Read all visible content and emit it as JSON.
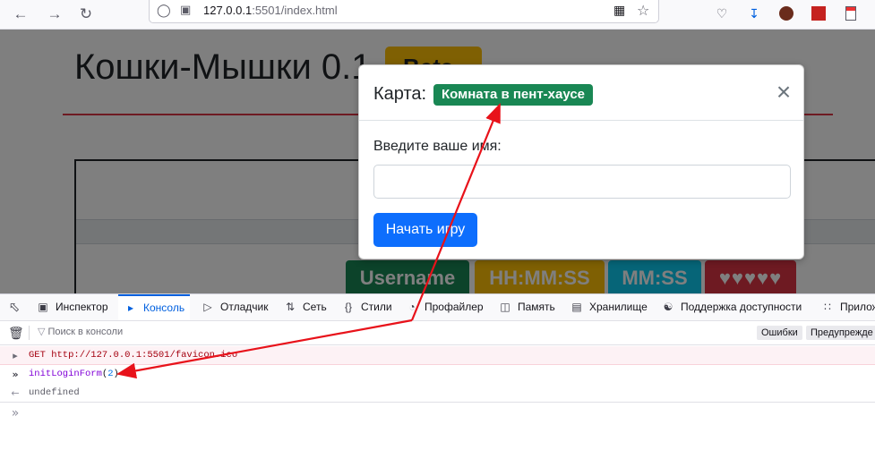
{
  "browser": {
    "url_host": "127.0.0.1",
    "url_rest": ":5501/index.html"
  },
  "page": {
    "title": "Кошки-Мышки 0.1",
    "title_badge": "Beta",
    "stats": [
      "Username",
      "HH:MM:SS",
      "MM:SS",
      "♥♥♥♥♥"
    ]
  },
  "modal": {
    "title": "Карта:",
    "map_badge": "Комната в пент-хаусе",
    "name_label": "Введите ваше имя:",
    "name_value": "",
    "start_button": "Начать игру"
  },
  "devtools": {
    "tabs": [
      {
        "label": "Инспектор",
        "icon": "inspector-icon"
      },
      {
        "label": "Консоль",
        "icon": "console-icon"
      },
      {
        "label": "Отладчик",
        "icon": "debugger-icon"
      },
      {
        "label": "Сеть",
        "icon": "network-icon"
      },
      {
        "label": "Стили",
        "icon": "styles-icon"
      },
      {
        "label": "Профайлер",
        "icon": "profiler-icon"
      },
      {
        "label": "Память",
        "icon": "memory-icon"
      },
      {
        "label": "Хранилище",
        "icon": "storage-icon"
      },
      {
        "label": "Поддержка доступности",
        "icon": "accessibility-icon"
      },
      {
        "label": "Прилож",
        "icon": "application-icon"
      }
    ],
    "filter_placeholder": "Поиск в консоли",
    "filters": [
      "Ошибки",
      "Предупрежде"
    ],
    "console": {
      "error_line": "GET http://127.0.0.1:5501/favicon.ico",
      "input_fn": "initLoginForm",
      "input_arg": "2",
      "result": "undefined"
    }
  },
  "colors": {
    "map_badge": "#198754",
    "start_button": "#0d6efd",
    "arrow": "#e8121a"
  }
}
